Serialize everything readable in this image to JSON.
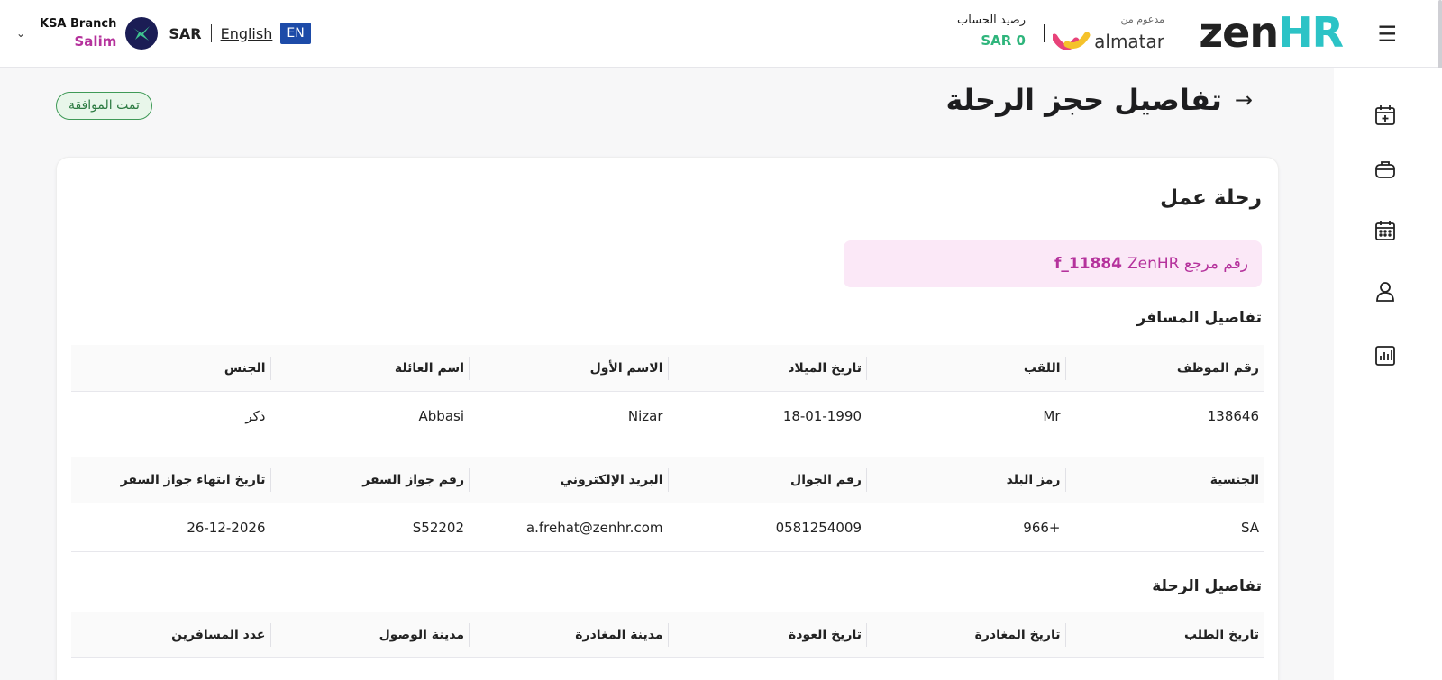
{
  "header": {
    "branch": "KSA Branch",
    "user": "Salim",
    "currency": "SAR",
    "language_link": "English",
    "language_badge": "EN",
    "balance_label": "رصيد الحساب",
    "balance_value": "SAR 0",
    "powered_label": "مدعوم من",
    "partner": "almatar",
    "brand_part1": "zen",
    "brand_part2": "HR"
  },
  "page": {
    "title": "تفاصيل حجز الرحلة",
    "status": "تمت الموافقة"
  },
  "card": {
    "title": "رحلة عمل",
    "ref_label": "رقم مرجع ZenHR",
    "ref_number": "11884_f",
    "traveler_section": "تفاصيل المسافر",
    "trip_section": "تفاصيل الرحلة"
  },
  "traveler": {
    "headers1": [
      "رقم الموظف",
      "اللقب",
      "تاريخ الميلاد",
      "الاسم الأول",
      "اسم العائلة",
      "الجنس"
    ],
    "values1": [
      "138646",
      "Mr",
      "18-01-1990",
      "Nizar",
      "Abbasi",
      "ذكر"
    ],
    "headers2": [
      "الجنسية",
      "رمز البلد",
      "رقم الجوال",
      "البريد الإلكتروني",
      "رقم جواز السفر",
      "تاريخ انتهاء جواز السفر"
    ],
    "values2": [
      "SA",
      "966+",
      "0581254009",
      "a.frehat@zenhr.com",
      "S52202",
      "26-12-2026"
    ]
  },
  "trip": {
    "headers": [
      "تاريخ الطلب",
      "تاريخ المغادرة",
      "تاريخ العودة",
      "مدينة المغادرة",
      "مدينة الوصول",
      "عدد المسافرين"
    ]
  },
  "colors": {
    "accent_magenta": "#b5329c",
    "balance_green": "#2fb57c",
    "brand_teal": "#2cc3c6",
    "badge_blue": "#1d4ba8"
  },
  "sidebar_icons": [
    "calendar-plus-icon",
    "briefcase-icon",
    "calendar-icon",
    "person-icon",
    "bar-chart-icon"
  ]
}
